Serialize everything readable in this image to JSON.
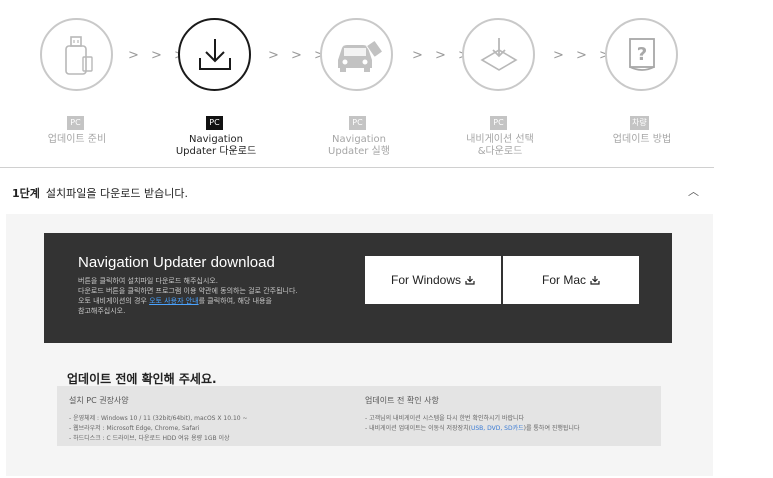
{
  "steps": [
    {
      "badge": "PC",
      "label_lines": [
        "업데이트 준비"
      ],
      "icon": "usb-drive-icon",
      "active": false
    },
    {
      "badge": "PC",
      "label_lines": [
        "Navigation",
        "Updater 다운로드"
      ],
      "icon": "download-icon",
      "active": true
    },
    {
      "badge": "PC",
      "label_lines": [
        "Navigation",
        "Updater 실행"
      ],
      "icon": "car-usb-icon",
      "active": false
    },
    {
      "badge": "PC",
      "label_lines": [
        "내비게이션 선택",
        "&다운로드"
      ],
      "icon": "select-download-icon",
      "active": false
    },
    {
      "badge": "차량",
      "label_lines": [
        "업데이트 방법"
      ],
      "icon": "manual-help-icon",
      "active": false
    }
  ],
  "step_separator": "> > >",
  "section": {
    "step_label": "1단계",
    "title": "설치파일을 다운로드 받습니다."
  },
  "download": {
    "title_bold": "Navigation Updater",
    "title_light": " download",
    "desc_line1": "버튼을 클릭하여 설치파일 다운로드 해주십시오.",
    "desc_line2": "다운로드 버튼을 클릭하면 프로그램 이용 약관에 동의하는 걸로 간주됩니다.",
    "desc_line3_pre": "오토 내비게이션의 경우 ",
    "desc_line3_link": "오토 사용자 안내",
    "desc_line3_post": "를 클릭하여, 해당 내용을",
    "desc_line4": "참고해주십시오.",
    "windows_label": "For Windows",
    "mac_label": "For Mac"
  },
  "check": {
    "title": "업데이트 전에 확인해 주세요.",
    "left_title": "설치 PC 권장사양",
    "left_lines": [
      "- 운영체제 : Windows 10 / 11 (32bit/64bit), macOS X 10.10 ~",
      "- 웹브라우저 : Microsoft Edge, Chrome, Safari",
      "- 하드디스크 : C 드라이브, 다운로드 HDD 여유 용량 1GB 이상"
    ],
    "right_title": "업데이트 전 확인 사항",
    "right_line1": "- 고객님의 내비게이션 시스템을 다시 한번 확인하시기 바랍니다",
    "right_line2_pre": "- 내비게이션 업데이트는 이동식 저장장치(",
    "right_line2_blue": "USB, DVD, SD카드",
    "right_line2_post": ")를 통하여 진행됩니다"
  },
  "colors": {
    "dark_panel": "#333333",
    "link_blue": "#4aa3ff",
    "inactive_gray": "#c4c4c4"
  }
}
